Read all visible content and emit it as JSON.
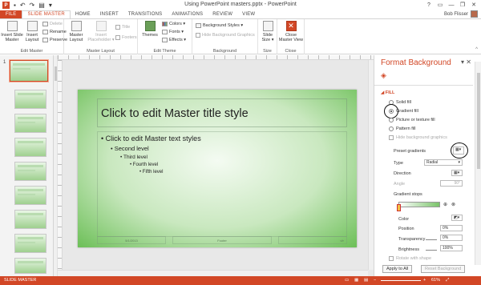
{
  "window": {
    "title": "Using PowerPoint masters.pptx - PowerPoint",
    "controls": [
      "?",
      "▭",
      "—",
      "❐",
      "✕"
    ]
  },
  "qat": {
    "undo": "↶",
    "redo": "↷",
    "slideshow": "▤",
    "customize": "▾"
  },
  "tabs": [
    "FILE",
    "SLIDE MASTER",
    "HOME",
    "INSERT",
    "TRANSITIONS",
    "ANIMATIONS",
    "REVIEW",
    "VIEW"
  ],
  "user": {
    "name": "Bob Flisser"
  },
  "ribbon": {
    "edit_master": {
      "label": "Edit Master",
      "insert_slide_master": "Insert Slide\nMaster",
      "insert_layout": "Insert\nLayout",
      "delete": "Delete",
      "rename": "Rename",
      "preserve": "Preserve"
    },
    "master_layout": {
      "label": "Master Layout",
      "master_layout": "Master\nLayout",
      "insert_placeholder": "Insert\nPlaceholder ▾",
      "title": "Title",
      "footers": "Footers"
    },
    "edit_theme": {
      "label": "Edit Theme",
      "themes": "Themes",
      "colors": "Colors ▾",
      "fonts": "Fonts ▾",
      "effects": "Effects ▾"
    },
    "background": {
      "label": "Background",
      "background_styles": "Background Styles ▾",
      "hide_background_graphics": "Hide Background Graphics"
    },
    "size": {
      "label": "Size",
      "slide_size": "Slide\nSize ▾"
    },
    "close": {
      "label": "Close",
      "close_master_view": "Close\nMaster View"
    }
  },
  "thumbnail_number": "1",
  "slide": {
    "title": "Click to edit Master title style",
    "levels": [
      "Click to edit Master text styles",
      "Second level",
      "Third level",
      "Fourth level",
      "Fifth level"
    ],
    "footer_left": "5/1/2013",
    "footer_center": "Footer",
    "footer_right": "‹#›"
  },
  "format_pane": {
    "title": "Format Background",
    "section": "FILL",
    "fill_options": [
      "Solid fill",
      "Gradient fill",
      "Picture or texture fill",
      "Pattern fill"
    ],
    "selected_fill": "Gradient fill",
    "hide_background_graphics": "Hide background graphics",
    "preset_gradients": "Preset gradients",
    "type_label": "Type",
    "type_value": "Radial",
    "direction_label": "Direction",
    "angle_label": "Angle",
    "angle_value": "90°",
    "gradient_stops": "Gradient stops",
    "color_label": "Color",
    "position_label": "Position",
    "position_value": "0%",
    "transparency_label": "Transparency",
    "transparency_value": "0%",
    "brightness_label": "Brightness",
    "brightness_value": "100%",
    "rotate_with_shape": "Rotate with shape",
    "apply_to_all": "Apply to All",
    "reset_background": "Reset Background"
  },
  "status": {
    "view": "SLIDE MASTER",
    "zoom": "61%"
  },
  "colors": {
    "accent": "#d24726",
    "slide_green": "#6cbf57"
  }
}
